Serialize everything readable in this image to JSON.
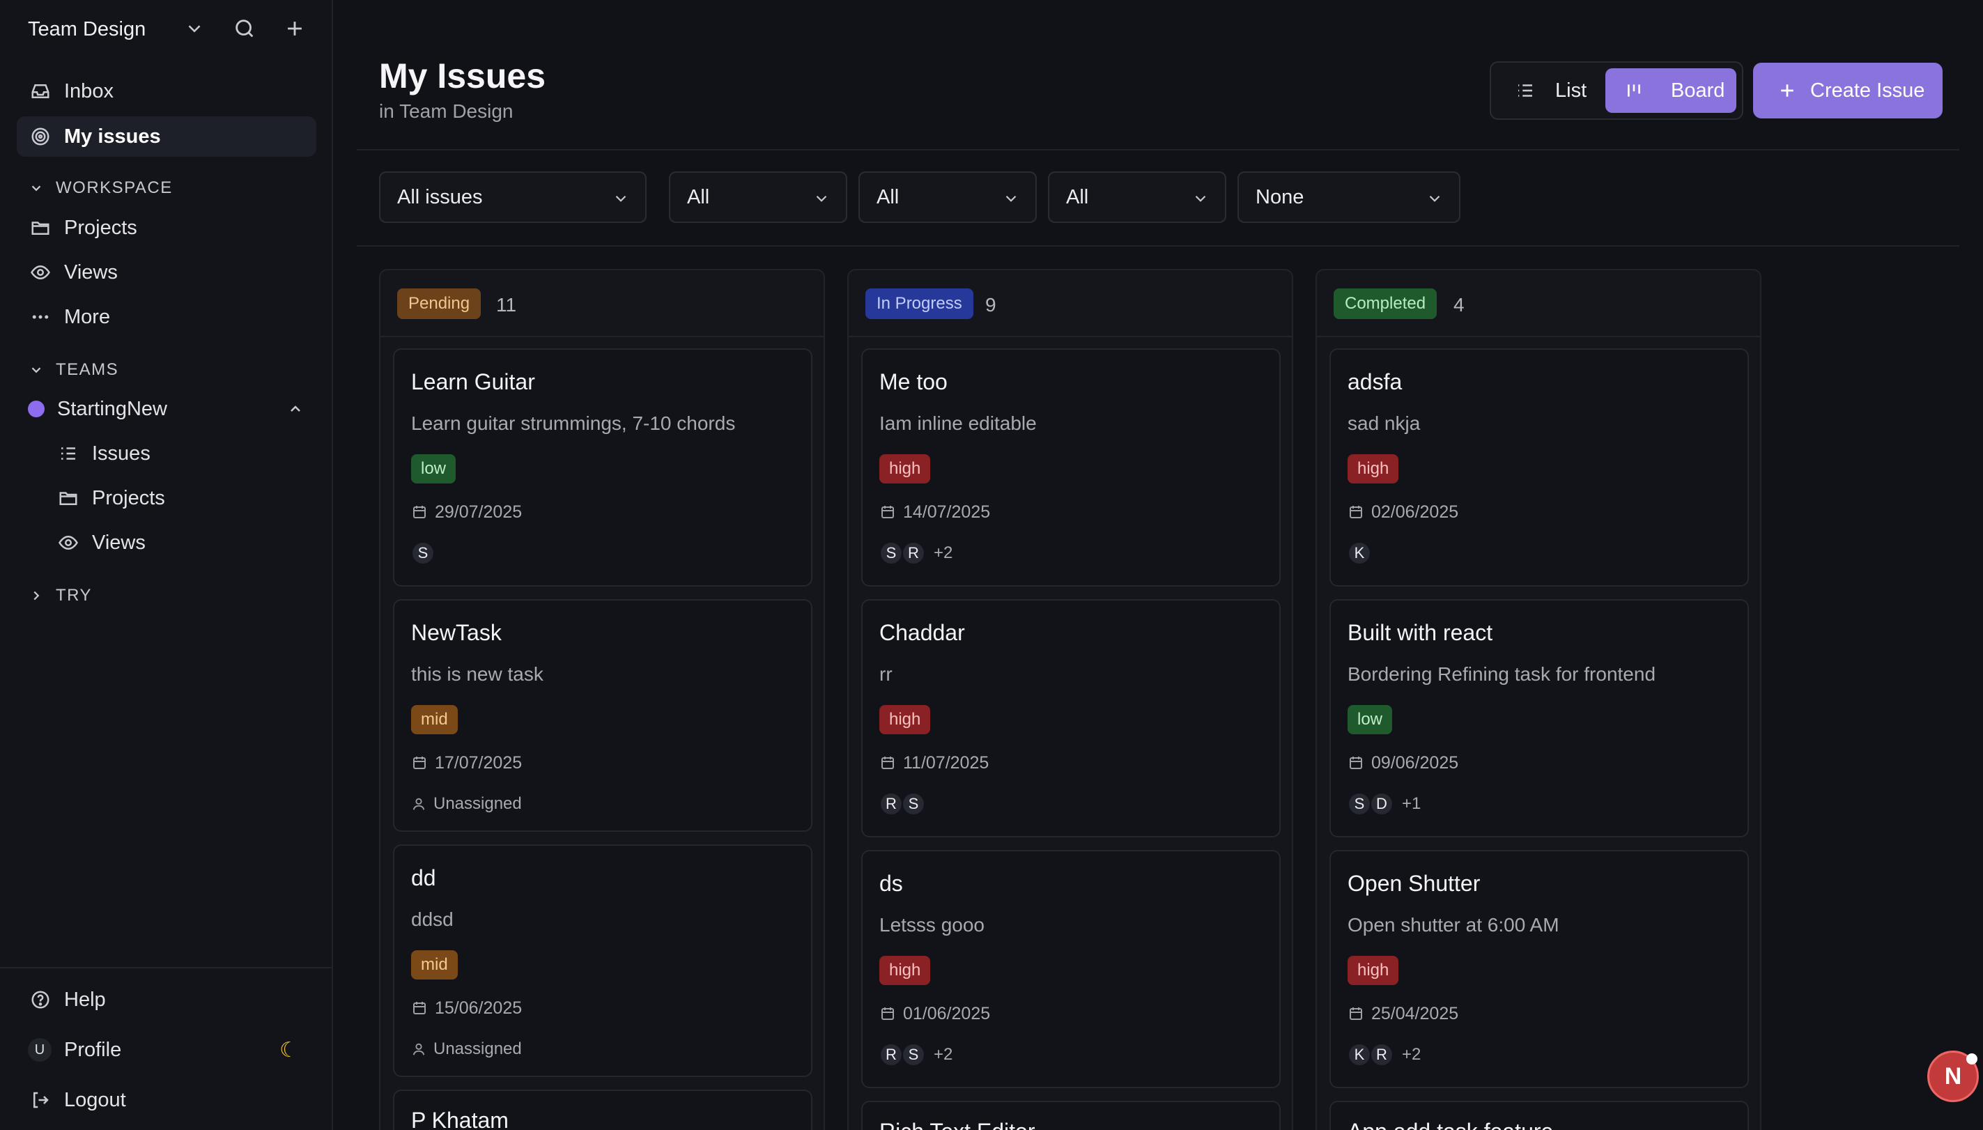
{
  "sidebar": {
    "workspace_name": "Team Design",
    "nav": [
      {
        "label": "Inbox",
        "icon": "inbox-icon"
      },
      {
        "label": "My issues",
        "icon": "target-icon",
        "active": true
      }
    ],
    "workspace_section": {
      "label": "WORKSPACE",
      "items": [
        {
          "label": "Projects",
          "icon": "folder-icon"
        },
        {
          "label": "Views",
          "icon": "eye-icon"
        },
        {
          "label": "More",
          "icon": "more-icon"
        }
      ]
    },
    "teams_section": {
      "label": "TEAMS",
      "team_name": "StartingNew",
      "team_color": "#8e6cf0",
      "items": [
        {
          "label": "Issues",
          "icon": "issues-list-icon"
        },
        {
          "label": "Projects",
          "icon": "folder-icon"
        },
        {
          "label": "Views",
          "icon": "eye-icon"
        }
      ]
    },
    "try_section": {
      "label": "TRY"
    },
    "bottom": {
      "help": "Help",
      "profile": "Profile",
      "profile_initial": "U",
      "logout": "Logout"
    }
  },
  "header": {
    "title": "My Issues",
    "subtitle": "in Team Design",
    "view_list": "List",
    "view_board": "Board",
    "create": "Create Issue"
  },
  "filters": [
    "All issues",
    "All",
    "All",
    "All",
    "None"
  ],
  "colors": {
    "accent": "#8a73dc",
    "pending": "#6b4219",
    "in_progress": "#26399a",
    "completed": "#1f5a2c",
    "priority_low": "#1f5a2c",
    "priority_mid": "#7b4818",
    "priority_high": "#8a2225"
  },
  "columns": [
    {
      "status": "Pending",
      "count": "11",
      "cards": [
        {
          "title": "Learn Guitar",
          "desc": "Learn guitar strummings, 7-10 chords",
          "priority": "low",
          "date": "29/07/2025",
          "assignees": [
            "S"
          ],
          "more": ""
        },
        {
          "title": "NewTask",
          "desc": "this is new task",
          "priority": "mid",
          "date": "17/07/2025",
          "unassigned": "Unassigned"
        },
        {
          "title": "dd",
          "desc": "ddsd",
          "priority": "mid",
          "date": "15/06/2025",
          "unassigned": "Unassigned"
        },
        {
          "title": "P Khatam"
        }
      ]
    },
    {
      "status": "In Progress",
      "count": "9",
      "cards": [
        {
          "title": "Me too",
          "desc": "Iam inline editable",
          "priority": "high",
          "date": "14/07/2025",
          "assignees": [
            "S",
            "R"
          ],
          "more": "+2"
        },
        {
          "title": "Chaddar",
          "desc": "rr",
          "priority": "high",
          "date": "11/07/2025",
          "assignees": [
            "R",
            "S"
          ],
          "more": ""
        },
        {
          "title": "ds",
          "desc": "Letsss gooo",
          "priority": "high",
          "date": "01/06/2025",
          "assignees": [
            "R",
            "S"
          ],
          "more": "+2"
        },
        {
          "title": "Rich Text Editor"
        }
      ]
    },
    {
      "status": "Completed",
      "count": "4",
      "cards": [
        {
          "title": "adsfa",
          "desc": "sad nkja",
          "priority": "high",
          "date": "02/06/2025",
          "assignees": [
            "K"
          ],
          "more": ""
        },
        {
          "title": "Built with react",
          "desc": "Bordering Refining task for frontend",
          "priority": "low",
          "date": "09/06/2025",
          "assignees": [
            "S",
            "D"
          ],
          "more": "+1"
        },
        {
          "title": "Open Shutter",
          "desc": "Open shutter at 6:00 AM",
          "priority": "high",
          "date": "25/04/2025",
          "assignees": [
            "K",
            "R"
          ],
          "more": "+2"
        },
        {
          "title": "App add task feature"
        }
      ]
    }
  ],
  "fab_label": "N"
}
